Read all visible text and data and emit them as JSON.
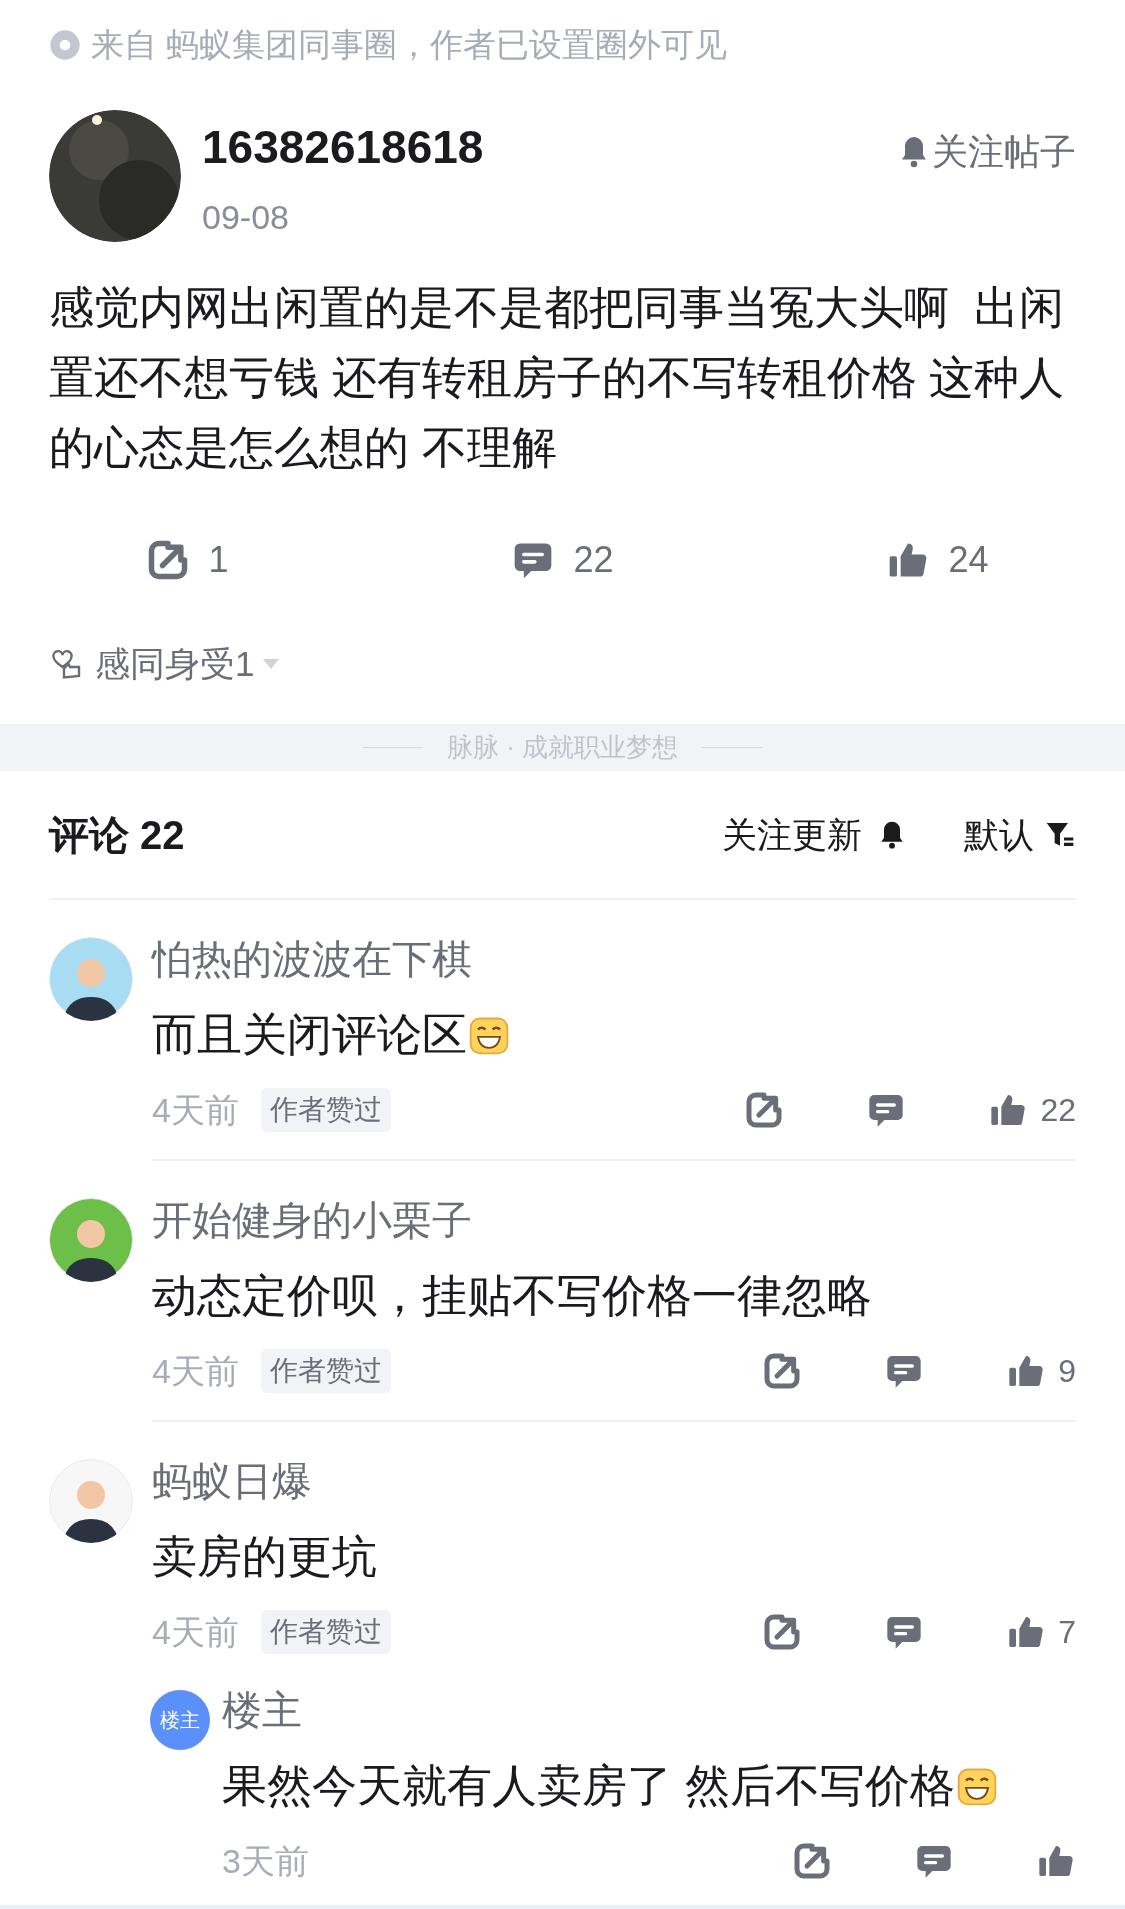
{
  "source_note": "来自 蚂蚁集团同事圈，作者已设置圈外可见",
  "post": {
    "author": "16382618618",
    "date": "09-08",
    "follow_label": "关注帖子",
    "text": "感觉内网出闲置的是不是都把同事当冤大头啊  出闲置还不想亏钱 还有转租房子的不写转租价格 这种人的心态是怎么想的 不理解",
    "actions": [
      {
        "kind": "share",
        "count": "1"
      },
      {
        "kind": "comment",
        "count": "22"
      },
      {
        "kind": "like",
        "count": "24"
      }
    ],
    "reaction": {
      "label": "感同身受1"
    }
  },
  "slogan": "脉脉 · 成就职业梦想",
  "comments_header": {
    "title": "评论 22",
    "follow_label": "关注更新",
    "sort_label": "默认"
  },
  "comments": [
    {
      "author": "怕热的波波在下棋",
      "text": "而且关闭评论区",
      "emoji": true,
      "time": "4天前",
      "badge": "作者赞过",
      "like_count": "22"
    },
    {
      "author": "开始健身的小栗子",
      "text": "动态定价呗，挂贴不写价格一律忽略",
      "emoji": false,
      "time": "4天前",
      "badge": "作者赞过",
      "like_count": "9"
    },
    {
      "author": "蚂蚁日爆",
      "text": "卖房的更坑",
      "emoji": false,
      "time": "4天前",
      "badge": "作者赞过",
      "like_count": "7",
      "replies": [
        {
          "author": "楼主",
          "avatar_label": "楼主",
          "text": "果然今天就有人卖房了 然后不写价格",
          "emoji": true,
          "time": "3天前"
        }
      ]
    }
  ]
}
